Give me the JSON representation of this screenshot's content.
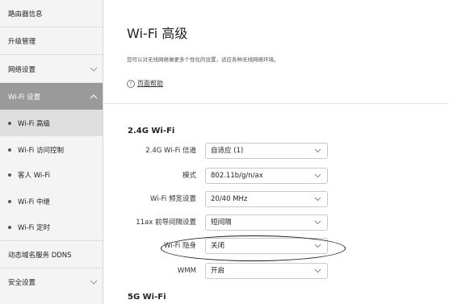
{
  "sidebar": {
    "items": [
      {
        "label": "路由器信息"
      },
      {
        "label": "升级管理"
      },
      {
        "label": "网络设置"
      },
      {
        "label": "Wi-Fi 设置"
      },
      {
        "label": "Wi-Fi 高级"
      },
      {
        "label": "Wi-Fi 访问控制"
      },
      {
        "label": "客人 Wi-Fi"
      },
      {
        "label": "Wi-Fi 中继"
      },
      {
        "label": "Wi-Fi 定时"
      },
      {
        "label": "动态域名服务 DDNS"
      },
      {
        "label": "安全设置"
      }
    ]
  },
  "main": {
    "title": "Wi-Fi 高级",
    "description": "您可以对无线网络做更多个性化的设置，适应各种无线网络环境。",
    "help_label": "页面帮助",
    "section_24": {
      "title": "2.4G Wi-Fi",
      "rows": [
        {
          "label": "2.4G Wi-Fi 信道",
          "value": "自适应 (1)"
        },
        {
          "label": "模式",
          "value": "802.11b/g/n/ax"
        },
        {
          "label": "Wi-Fi 频宽设置",
          "value": "20/40 MHz"
        },
        {
          "label": "11ax 前导间隔设置",
          "value": "短间隔"
        },
        {
          "label": "Wi-Fi 隐身",
          "value": "关闭"
        },
        {
          "label": "WMM",
          "value": "开启"
        }
      ]
    },
    "section_5": {
      "title": "5G Wi-Fi"
    }
  },
  "icons": {
    "chevron_down": "chevron-down-icon",
    "chevron_up": "chevron-up-icon",
    "help": "question-circle-icon",
    "select_arrow": "select-arrow-icon"
  },
  "colors": {
    "sidebar_bg": "#f4f4f4",
    "active_parent_bg": "#9a9a9a",
    "active_sub_bg": "#dedede"
  }
}
